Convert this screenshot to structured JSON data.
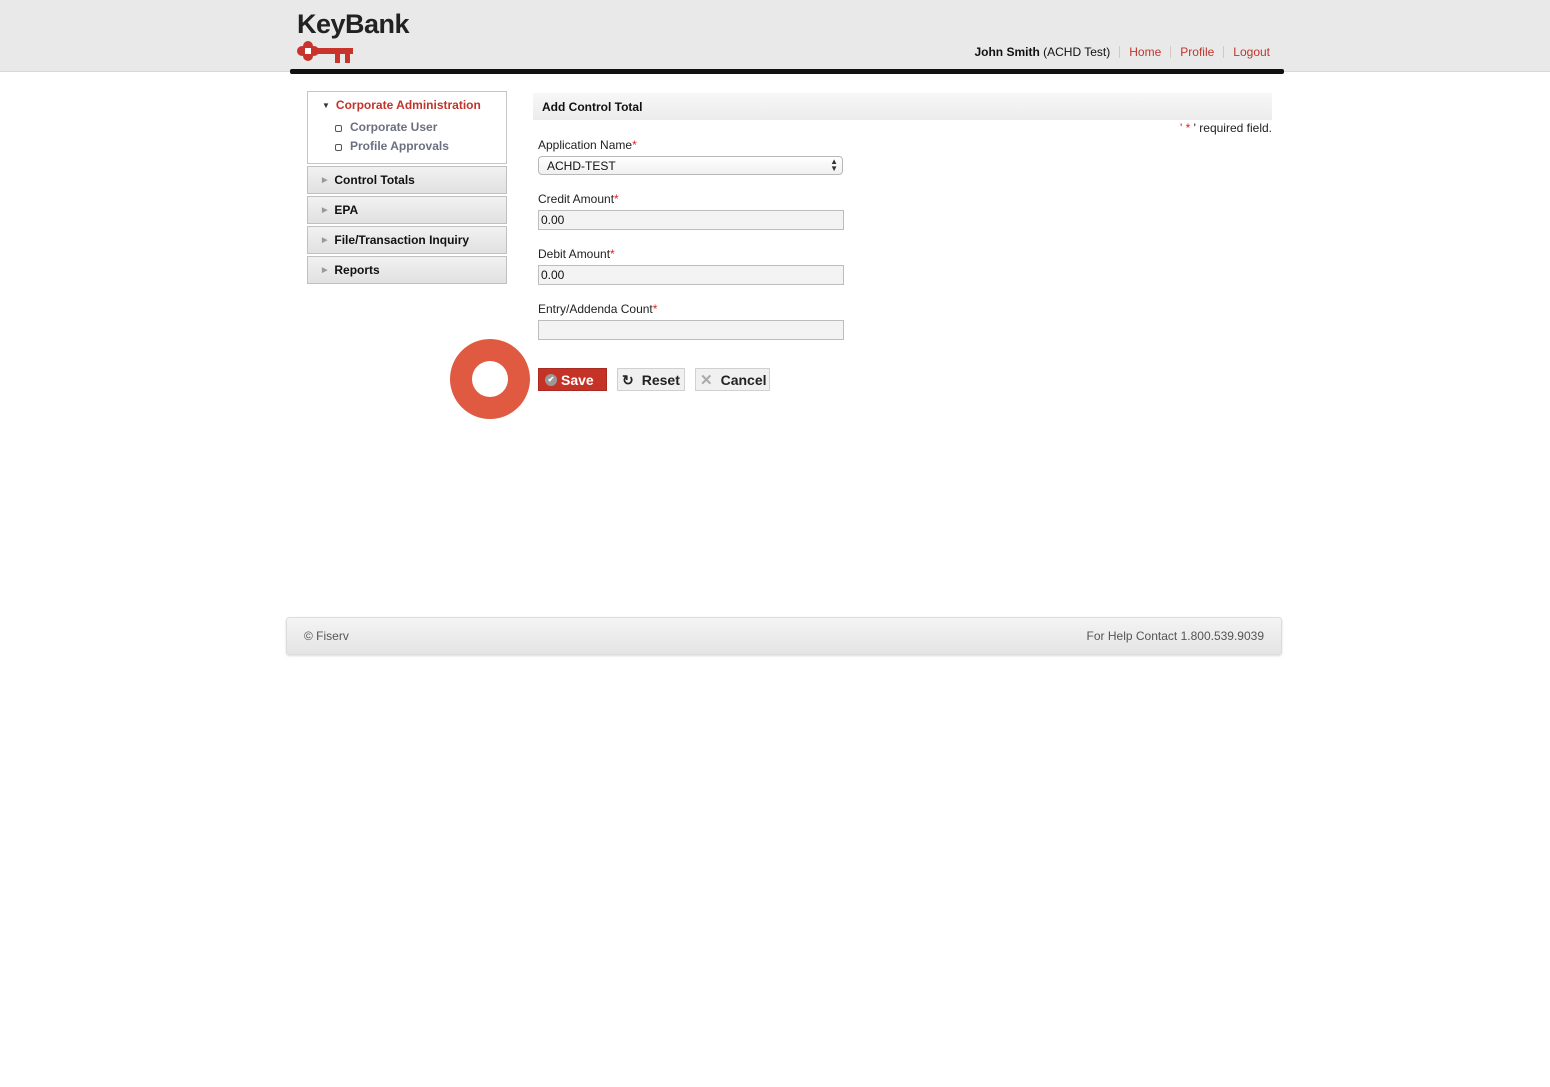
{
  "brand": {
    "name": "KeyBank",
    "logo_icon": "key-icon",
    "accent_color": "#c0352b"
  },
  "header": {
    "user_name": "John Smith",
    "user_org": "(ACHD Test)",
    "links": [
      {
        "label": "Home"
      },
      {
        "label": "Profile"
      },
      {
        "label": "Logout"
      }
    ]
  },
  "sidebar": {
    "expanded_section": {
      "label": "Corporate Administration",
      "items": [
        {
          "label": "Corporate User"
        },
        {
          "label": "Profile Approvals"
        }
      ]
    },
    "sections": [
      {
        "label": "Control Totals"
      },
      {
        "label": "EPA"
      },
      {
        "label": "File/Transaction Inquiry"
      },
      {
        "label": "Reports"
      }
    ]
  },
  "form": {
    "title": "Add Control Total",
    "required_note_prefix": "' ",
    "required_star": "*",
    "required_note_suffix": " ' required field.",
    "fields": {
      "application_name": {
        "label": "Application Name",
        "value": "ACHD-TEST"
      },
      "credit_amount": {
        "label": "Credit Amount",
        "value": "0.00"
      },
      "debit_amount": {
        "label": "Debit Amount",
        "value": "0.00"
      },
      "entry_count": {
        "label": "Entry/Addenda Count",
        "value": ""
      }
    },
    "buttons": {
      "save": "Save",
      "reset": "Reset",
      "cancel": "Cancel"
    }
  },
  "footer": {
    "copyright": "© Fiserv",
    "help": "For Help Contact 1.800.539.9039"
  }
}
